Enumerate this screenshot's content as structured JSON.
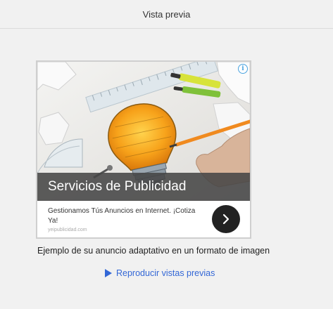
{
  "header": {
    "title": "Vista previa"
  },
  "ad": {
    "title": "Servicios de Publicidad",
    "description": "Gestionamos Tús Anuncios en Internet. ¡Cotiza Ya!",
    "url": "yeipublicidad.com",
    "info_icon": "i",
    "image_icon": "lightbulb-drawing-image",
    "cta_icon": "chevron-right-icon"
  },
  "caption": "Ejemplo de su anuncio adaptativo en un formato de imagen",
  "replay_link": {
    "label": "Reproducir vistas previas",
    "icon": "play-icon",
    "color": "#3367d6"
  }
}
